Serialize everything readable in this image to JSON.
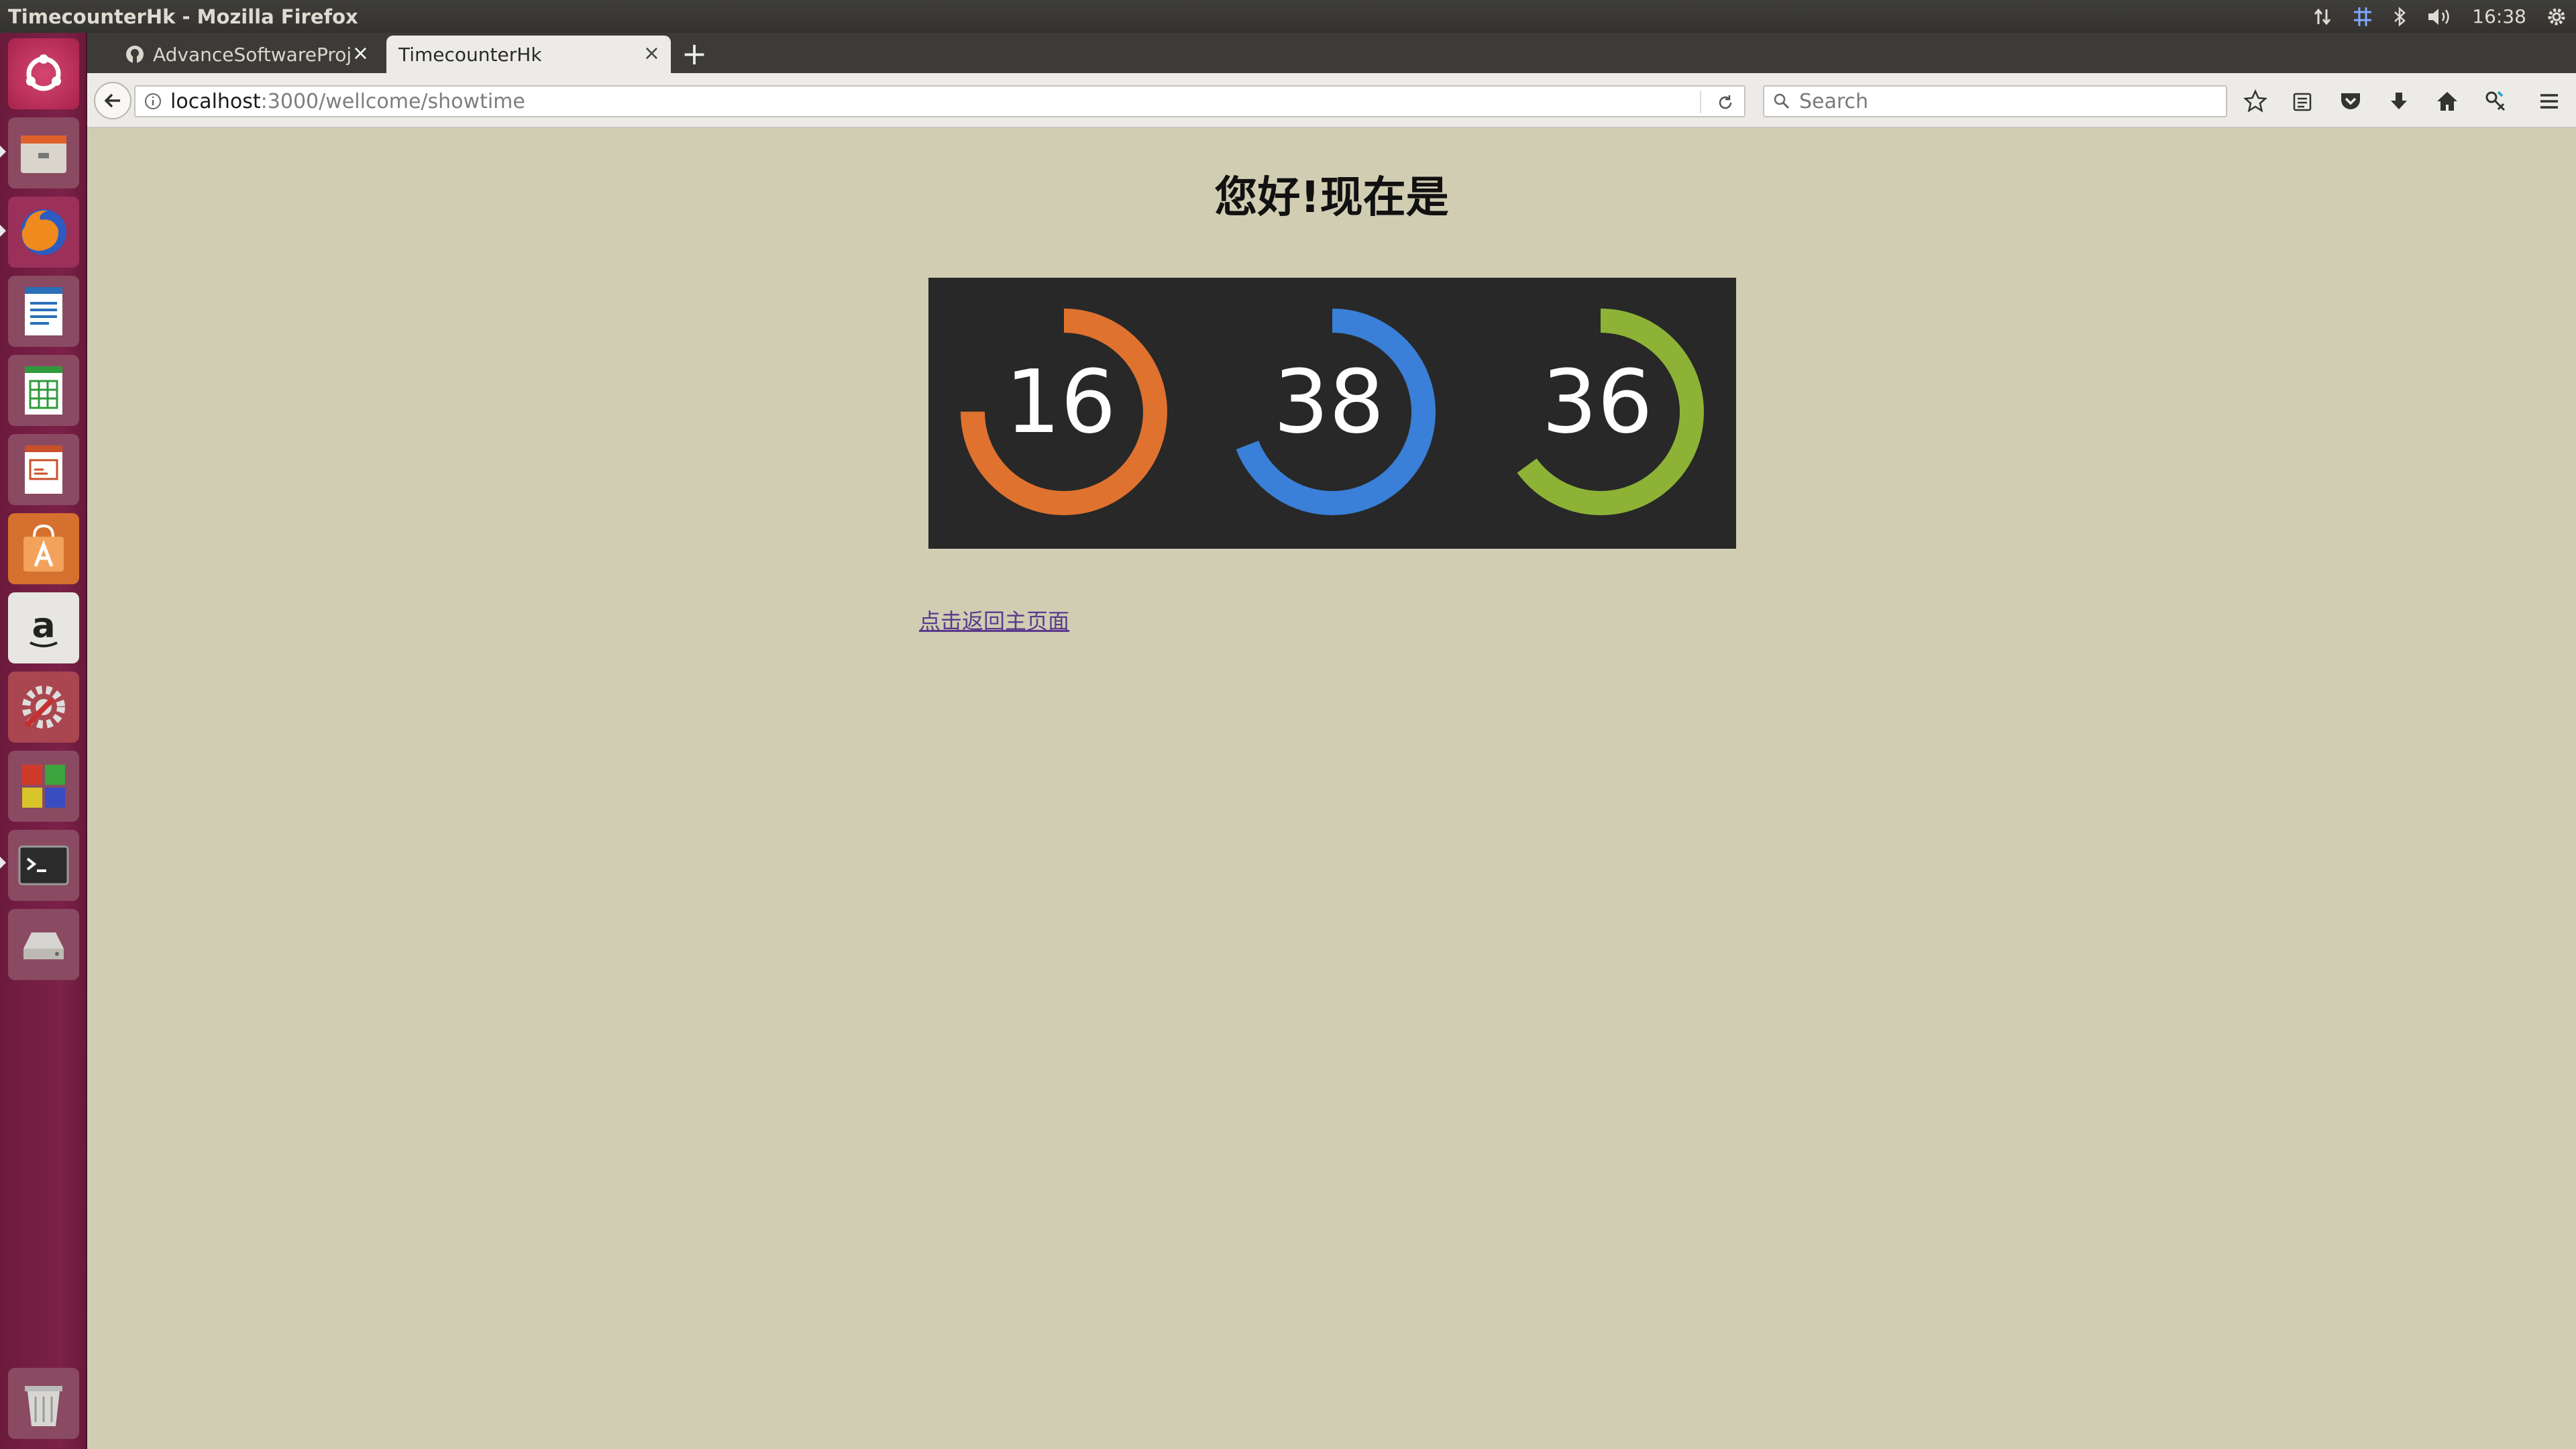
{
  "window": {
    "title": "TimecounterHk - Mozilla Firefox"
  },
  "panel": {
    "clock": "16:38"
  },
  "launcher": {
    "items": [
      "ubuntu-dash-icon",
      "files-icon",
      "firefox-icon",
      "writer-icon",
      "calc-icon",
      "impress-icon",
      "software-center-icon",
      "amazon-icon",
      "system-settings-icon",
      "workspaces-icon",
      "terminal-icon",
      "disk-icon",
      "trash-icon"
    ]
  },
  "tabs": [
    {
      "label": "AdvanceSoftwareProj",
      "close": "×"
    },
    {
      "label": "TimecounterHk",
      "close": "×"
    }
  ],
  "new_tab": "+",
  "url": {
    "host": "localhost",
    "path": ":3000/wellcome/showtime"
  },
  "search": {
    "placeholder": "Search"
  },
  "page": {
    "title": "您好!现在是",
    "link": "点击返回主页面"
  },
  "clock": {
    "hours": "16",
    "minutes": "38",
    "seconds": "36",
    "colors": {
      "hours": "#e0722f",
      "minutes": "#3a7fd8",
      "seconds": "#8db236",
      "background": "#282828"
    }
  }
}
